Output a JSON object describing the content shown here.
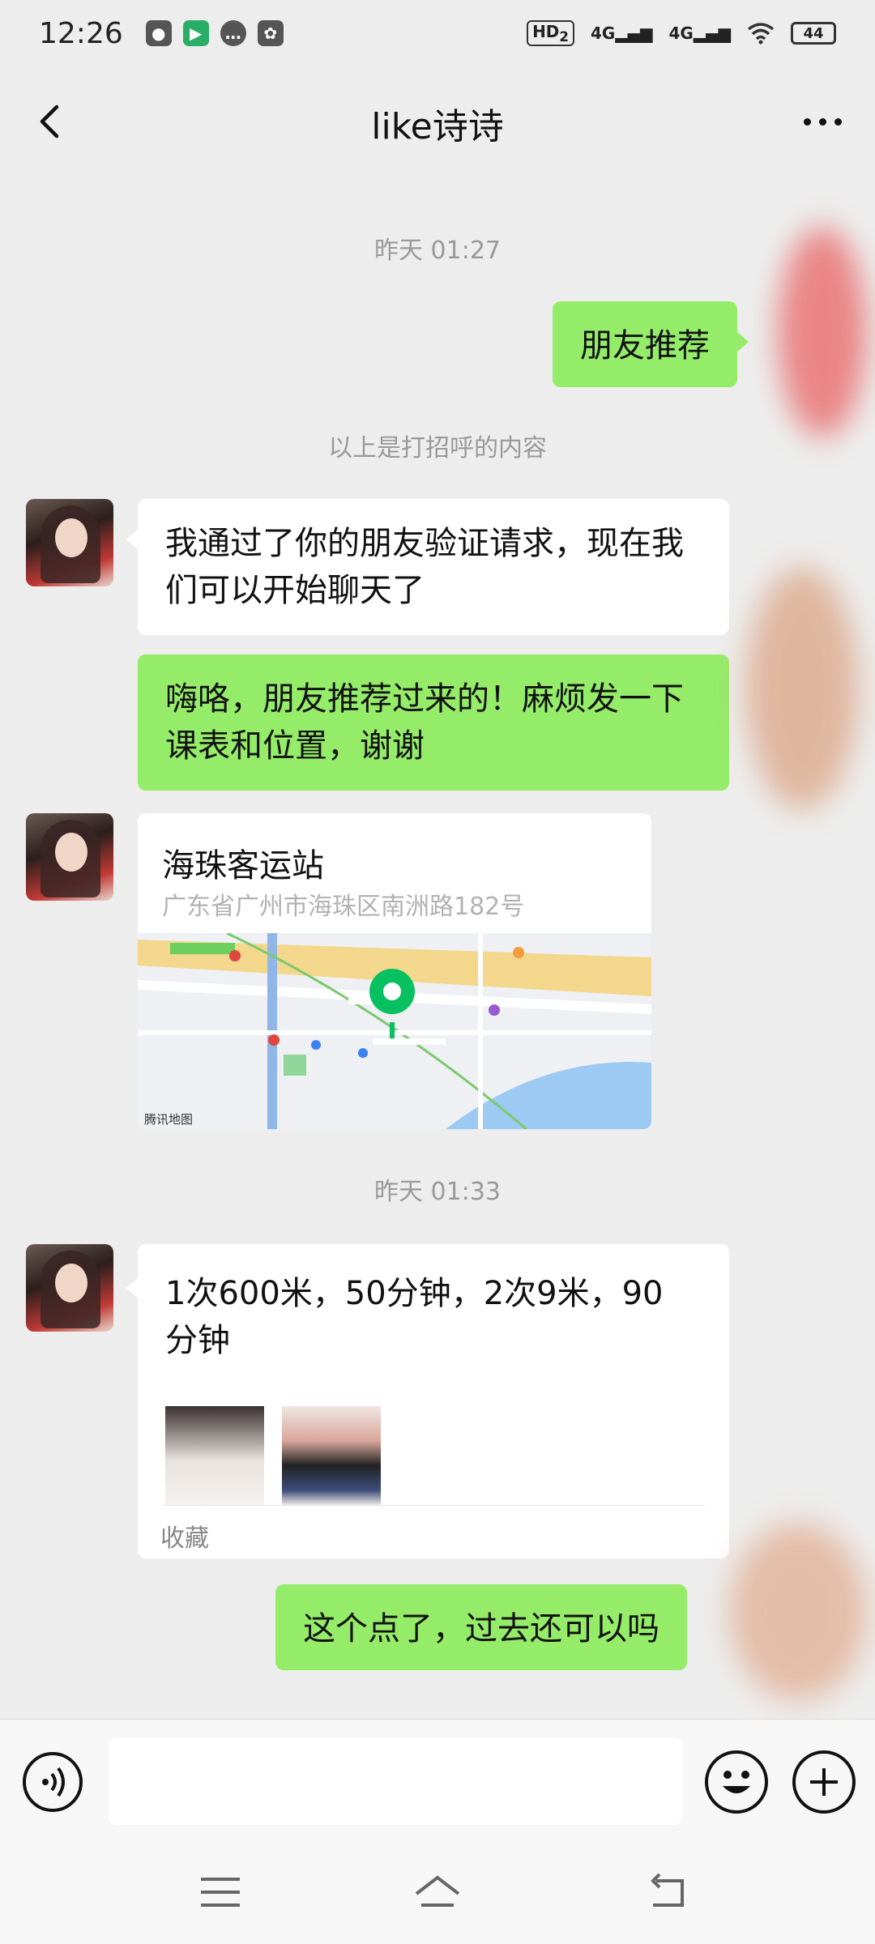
{
  "status_bar": {
    "time": "12:26",
    "network_badge": "HD",
    "network_badge_sub": "2",
    "signal_1": "4G",
    "signal_2": "4G",
    "battery": "44"
  },
  "header": {
    "title": "like诗诗"
  },
  "messages": {
    "timestamp_1": "昨天 01:27",
    "sent_1": "朋友推荐",
    "system_note": "以上是打招呼的内容",
    "received_1": "我通过了你的朋友验证请求，现在我们可以开始聊天了",
    "sent_2": "嗨咯，朋友推荐过来的！麻烦发一下课表和位置，谢谢",
    "location": {
      "name": "海珠客运站",
      "address": "广东省广州市海珠区南洲路182号",
      "map_credit": "腾讯地图"
    },
    "timestamp_2": "昨天 01:33",
    "favorite": {
      "text": "1次600米，50分钟，2次9米，90分钟",
      "footer": "收藏"
    },
    "sent_3": "这个点了，过去还可以吗"
  },
  "input_bar": {
    "placeholder": ""
  },
  "colors": {
    "background": "#ededed",
    "sent_bubble": "#95ec69",
    "received_bubble": "#ffffff",
    "map_pin": "#07c160"
  }
}
